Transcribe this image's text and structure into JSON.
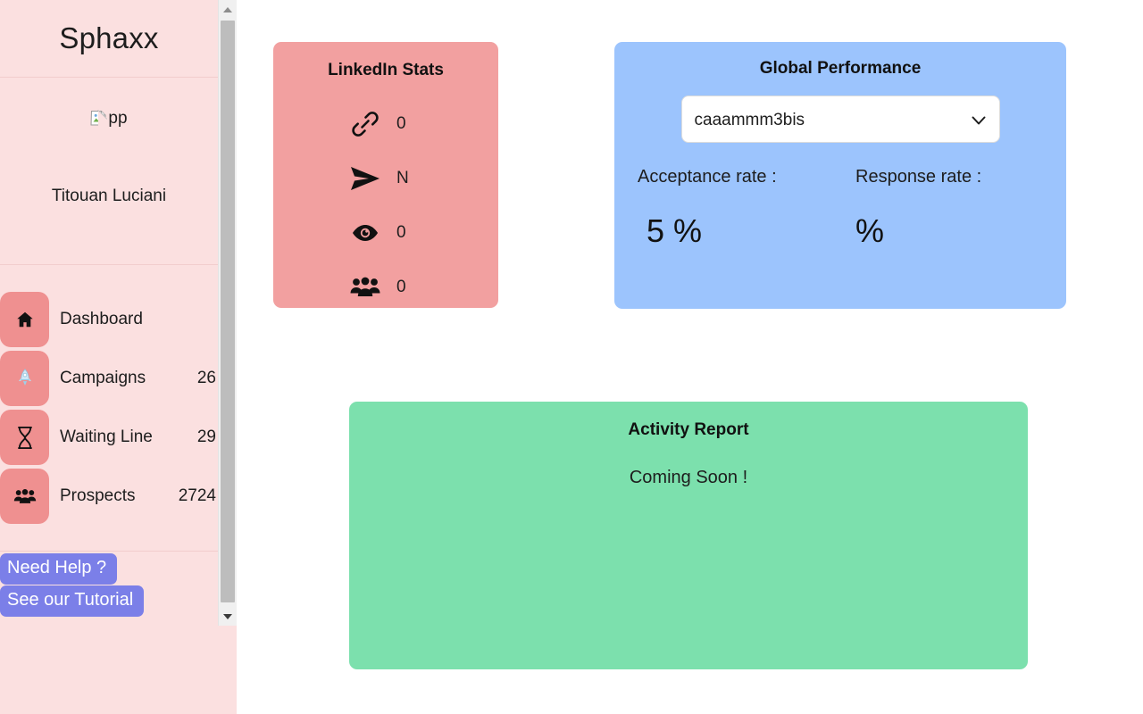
{
  "sidebar": {
    "brand": "Sphaxx",
    "profile": {
      "avatar_alt": "pp",
      "avatar_icon": "broken-image-icon",
      "name": "Titouan Luciani"
    },
    "nav": [
      {
        "label": "Dashboard",
        "count": "",
        "icon": "home-icon"
      },
      {
        "label": "Campaigns",
        "count": "26",
        "icon": "rocket-icon"
      },
      {
        "label": "Waiting Line",
        "count": "29",
        "icon": "hourglass-icon"
      },
      {
        "label": "Prospects",
        "count": "2724",
        "icon": "people-icon"
      }
    ],
    "help": {
      "need_help": "Need Help ?",
      "tutorial": "See our Tutorial"
    },
    "scrollbar": {
      "up_icon": "scroll-up-arrow-icon",
      "down_icon": "scroll-down-arrow-icon"
    }
  },
  "linkedin_card": {
    "title": "LinkedIn Stats",
    "stats": [
      {
        "icon": "link-icon",
        "value": "0"
      },
      {
        "icon": "send-icon",
        "value": "N"
      },
      {
        "icon": "eye-icon",
        "value": "0"
      },
      {
        "icon": "people-group-icon",
        "value": "0"
      }
    ]
  },
  "global_card": {
    "title": "Global Performance",
    "campaign_select": {
      "value": "caaammm3bis",
      "chevron_icon": "chevron-down-icon"
    },
    "acceptance": {
      "label": "Acceptance rate :",
      "value": "5 %"
    },
    "response": {
      "label": "Response rate :",
      "value": "%"
    }
  },
  "activity_card": {
    "title": "Activity Report",
    "message": "Coming Soon !"
  },
  "colors": {
    "sidebar_bg": "#fbe0e0",
    "nav_badge": "#ef9090",
    "help_button": "#7b7fe8",
    "linkedin_card": "#f2a0a0",
    "global_card": "#9cc4fd",
    "activity_card": "#7ce0ad",
    "page_bg": "#ffffff"
  }
}
